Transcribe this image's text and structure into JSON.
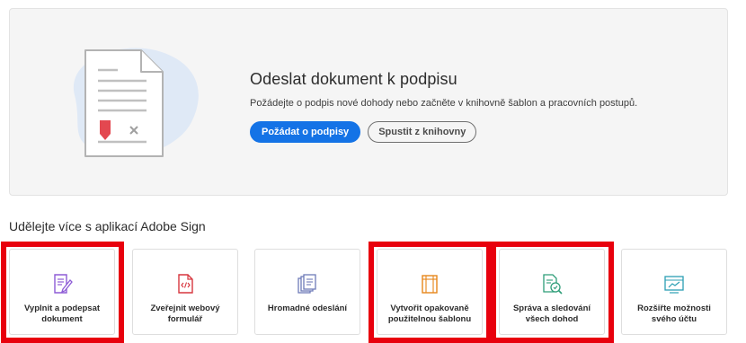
{
  "hero": {
    "title": "Odeslat dokument k podpisu",
    "subtitle": "Požádejte o podpis nové dohody nebo začněte v knihovně šablon a pracovních postupů.",
    "primary_button": "Požádat o podpisy",
    "secondary_button": "Spustit z knihovny",
    "illustration_icon": "document-signature-illustration"
  },
  "section": {
    "title": "Udělejte více s aplikací Adobe Sign"
  },
  "cards": [
    {
      "label": "Vyplnit a podepsat dokument",
      "icon": "fill-sign-icon",
      "highlighted": true
    },
    {
      "label": "Zveřejnit webový formulář",
      "icon": "web-form-icon",
      "highlighted": false
    },
    {
      "label": "Hromadné odeslání",
      "icon": "bulk-send-icon",
      "highlighted": false
    },
    {
      "label": "Vytvořit opakovaně použitelnou šablonu",
      "icon": "reusable-template-icon",
      "highlighted": true
    },
    {
      "label": "Správa a sledování všech dohod",
      "icon": "manage-agreements-icon",
      "highlighted": true
    },
    {
      "label": "Rozšiřte možnosti svého účtu",
      "icon": "account-upgrade-icon",
      "highlighted": false
    }
  ],
  "colors": {
    "primary": "#1473e6",
    "highlight": "#e8000d",
    "blob": "#dfe9f6",
    "signature_red": "#e34850"
  }
}
